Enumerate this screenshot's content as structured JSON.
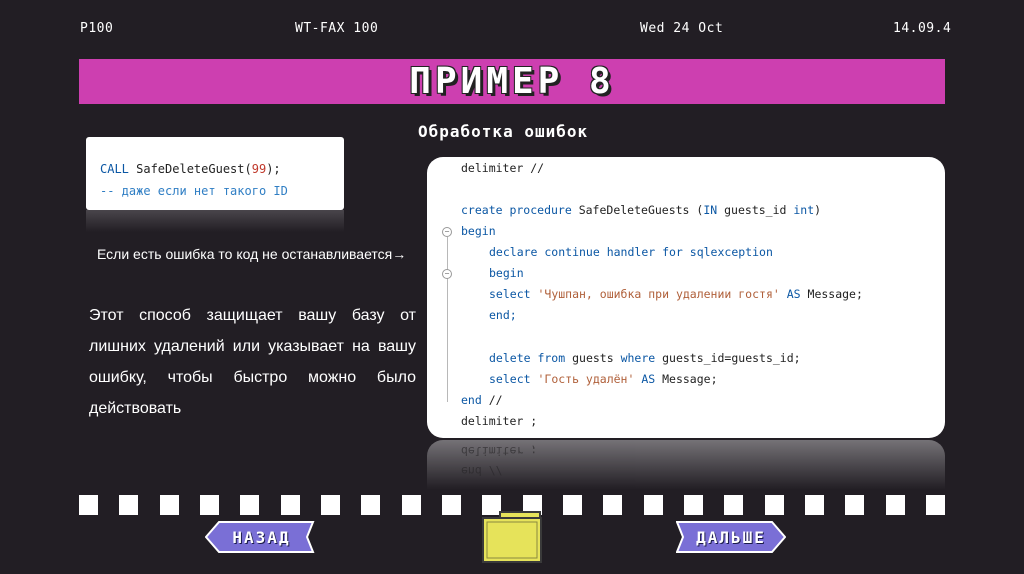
{
  "header": {
    "left": "P100",
    "center": "WT-FAX 100",
    "date": "Wed 24 Oct",
    "right": "14.09.4"
  },
  "banner": {
    "title": "ПРИМЕР 8"
  },
  "subtitle": "Обработка ошибок",
  "small_code": {
    "line1_kw": "CALL",
    "line1_fn": " SafeDeleteGuest(",
    "line1_num": "99",
    "line1_end": ");",
    "line2": " -- даже если нет такого ID"
  },
  "note": "Если есть ошибка то код не останавливается→",
  "paragraph": "Этот способ защищает вашу базу от лишних удалений или указывает на вашу ошибку, чтобы быстро можно было действовать",
  "code": {
    "l1": "delimiter //",
    "l3a": "create procedure",
    "l3b": " SafeDeleteGuests (",
    "l3c": "IN",
    "l3d": " guests_id ",
    "l3e": "int",
    "l3f": ")",
    "l4": "begin",
    "l5": "declare continue handler for sqlexception",
    "l6": "begin",
    "l7a": "select",
    "l7b": " 'Чушпан, ошибка при удалении гостя' ",
    "l7c": "AS",
    "l7d": " Message;",
    "l8": "end;",
    "l10a": "delete from",
    "l10b": " guests ",
    "l10c": "where",
    "l10d": " guests_id=guests_id;",
    "l11a": "select",
    "l11b": " 'Гость удалён' ",
    "l11c": "AS",
    "l11d": " Message;",
    "l12a": "end",
    "l12b": " //",
    "l13": "delimiter ;"
  },
  "nav": {
    "back": "НАЗАД",
    "next": "ДАЛЬШЕ"
  },
  "colors": {
    "background": "#221e24",
    "banner": "#cd3fb0",
    "nav_button": "#7a6fd6",
    "folder": "#e6e35a"
  }
}
